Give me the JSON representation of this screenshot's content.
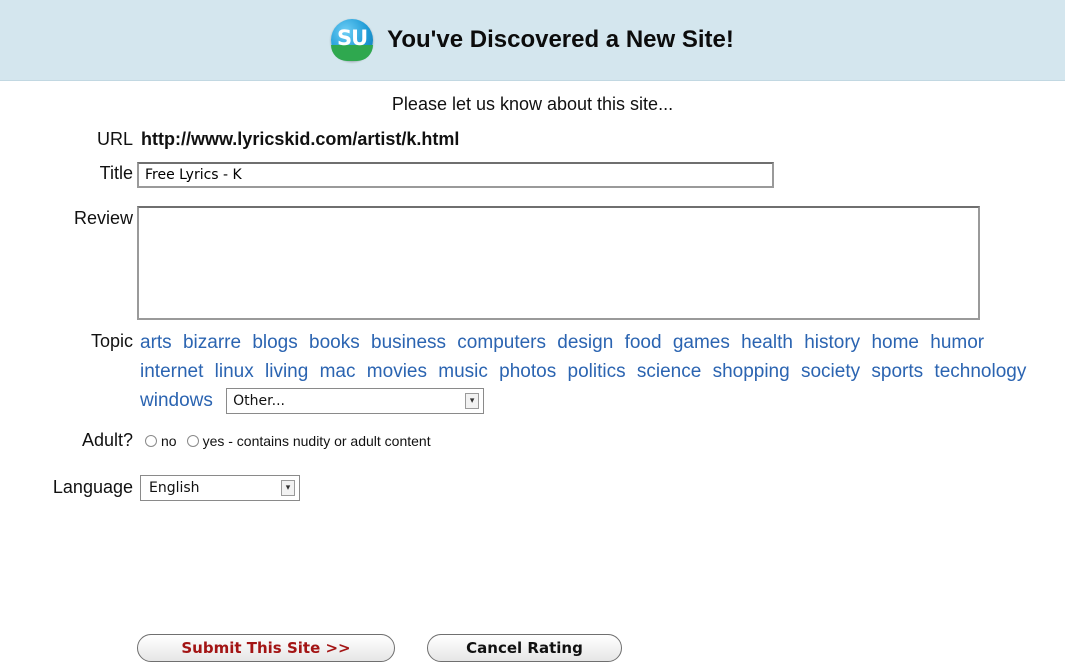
{
  "banner": {
    "logo_text": "SU",
    "title": "You've Discovered a New Site!"
  },
  "subtitle": "Please let us know about this site...",
  "url": {
    "label": "URL",
    "value": "http://www.lyricskid.com/artist/k.html"
  },
  "title_field": {
    "label": "Title",
    "value": "Free Lyrics - K"
  },
  "review_field": {
    "label": "Review",
    "value": ""
  },
  "topic": {
    "label": "Topic",
    "links": [
      "arts",
      "bizarre",
      "blogs",
      "books",
      "business",
      "computers",
      "design",
      "food",
      "games",
      "health",
      "history",
      "home",
      "humor",
      "internet",
      "linux",
      "living",
      "mac",
      "movies",
      "music",
      "photos",
      "politics",
      "science",
      "shopping",
      "society",
      "sports",
      "technology",
      "windows"
    ],
    "other_select": "Other..."
  },
  "adult": {
    "label": "Adult?",
    "option_no": "no",
    "option_yes": "yes - contains nudity or adult content"
  },
  "language": {
    "label": "Language",
    "selected": "English"
  },
  "buttons": {
    "submit": "Submit This Site >>",
    "cancel": "Cancel Rating"
  },
  "colors": {
    "banner_bg": "#d4e6ee",
    "link": "#2b64b1",
    "submit_text": "#a31414"
  }
}
